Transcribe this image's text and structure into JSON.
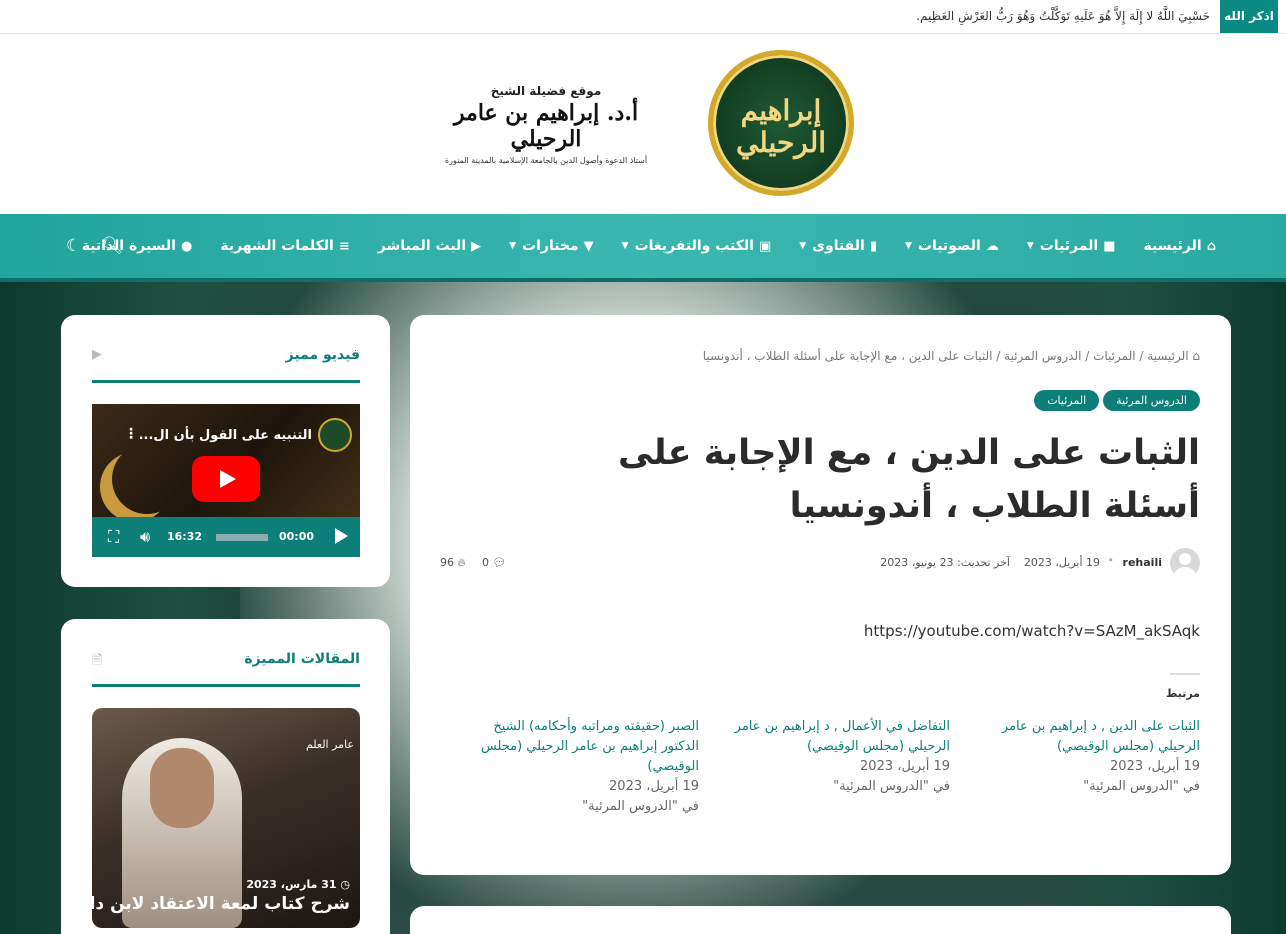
{
  "topbar": {
    "badge": "اذكر الله",
    "zikr": "حَسْبِيَ اللَّهُ لا إِلَهَ إِلاَّ هُوَ عَلَيهِ تَوَكَّلْتُ وَهُوَ رَبُّ العَرْشِ العَظِيم."
  },
  "header": {
    "logo_calligraphy": "إبراهيم الرحيلي",
    "site_label": "موقع فضيلة الشيخ",
    "site_name": "أ.د. إبراهيم بن عامر الرحيلي",
    "site_subtitle": "أستاذ الدعوة وأصول الدين بالجامعة الإسلامية بالمدينة المنورة"
  },
  "nav": {
    "items": [
      {
        "label": "الرئيسية",
        "icon": "home-icon"
      },
      {
        "label": "المرئيات",
        "icon": "video-icon",
        "dropdown": true
      },
      {
        "label": "الصوتيات",
        "icon": "cloud-icon",
        "dropdown": true
      },
      {
        "label": "الفتاوى",
        "icon": "book-icon",
        "dropdown": true
      },
      {
        "label": "الكتب والتفريغات",
        "icon": "open-book-icon",
        "dropdown": true
      },
      {
        "label": "مختارات",
        "icon": "bookmark-icon",
        "dropdown": true
      },
      {
        "label": "البث المباشر",
        "icon": "youtube-icon"
      },
      {
        "label": "الكلمات الشهرية",
        "icon": "list-icon"
      },
      {
        "label": "السيرة الذاتية",
        "icon": "user-icon"
      }
    ]
  },
  "article": {
    "breadcrumb": "الرئيسية / المرئيات / الدروس المرئية / الثبات على الدين ، مع الإجابة على أسئلة الطلاب ، أندونسيا",
    "tags": [
      "الدروس المرئية",
      "المرئيات"
    ],
    "title": "الثبات على الدين ، مع الإجابة على أسئلة الطلاب ، أندونسيا",
    "author": "rehaili",
    "date": "19 أبريل، 2023",
    "updated": "آخر تحديث: 23 يونيو، 2023",
    "comments": "0",
    "views": "96",
    "link": "https://youtube.com/watch?v=SAzM_akSAqk",
    "related_heading": "مرتبط",
    "related": [
      {
        "title": "الثبات على الدين , د إبراهيم بن عامر الرحيلي (مجلس الوقيصي)",
        "date": "19 أبريل، 2023",
        "category": "في \"الدروس المرئية\""
      },
      {
        "title": "التفاضل في الأعمال , د إبراهيم بن عامر الرحيلي (مجلس الوقيصي)",
        "date": "19 أبريل، 2023",
        "category": "في \"الدروس المرئية\""
      },
      {
        "title": "الصبر (حقيقته ومراتبه وأحكامه) الشيخ الدكتور إبراهيم بن عامر الرحيلي (مجلس الوقيصي)",
        "date": "19 أبريل، 2023",
        "category": "في \"الدروس المرئية\""
      }
    ]
  },
  "sidebar": {
    "video_widget": {
      "heading": "فيديو مميز",
      "video_title": "التنبيه على القول بأن ال...",
      "current_time": "00:00",
      "duration": "16:32"
    },
    "featured_widget": {
      "heading": "المقالات المميزة",
      "channel": "عامر العلم",
      "date": "31 مارس، 2023",
      "title": "شرح كتاب لمعة الاعتقاد لابن دام"
    }
  },
  "colors": {
    "accent": "#0d7f78",
    "nav_bg": "#2aa9a2",
    "gold": "#d4a92a"
  }
}
